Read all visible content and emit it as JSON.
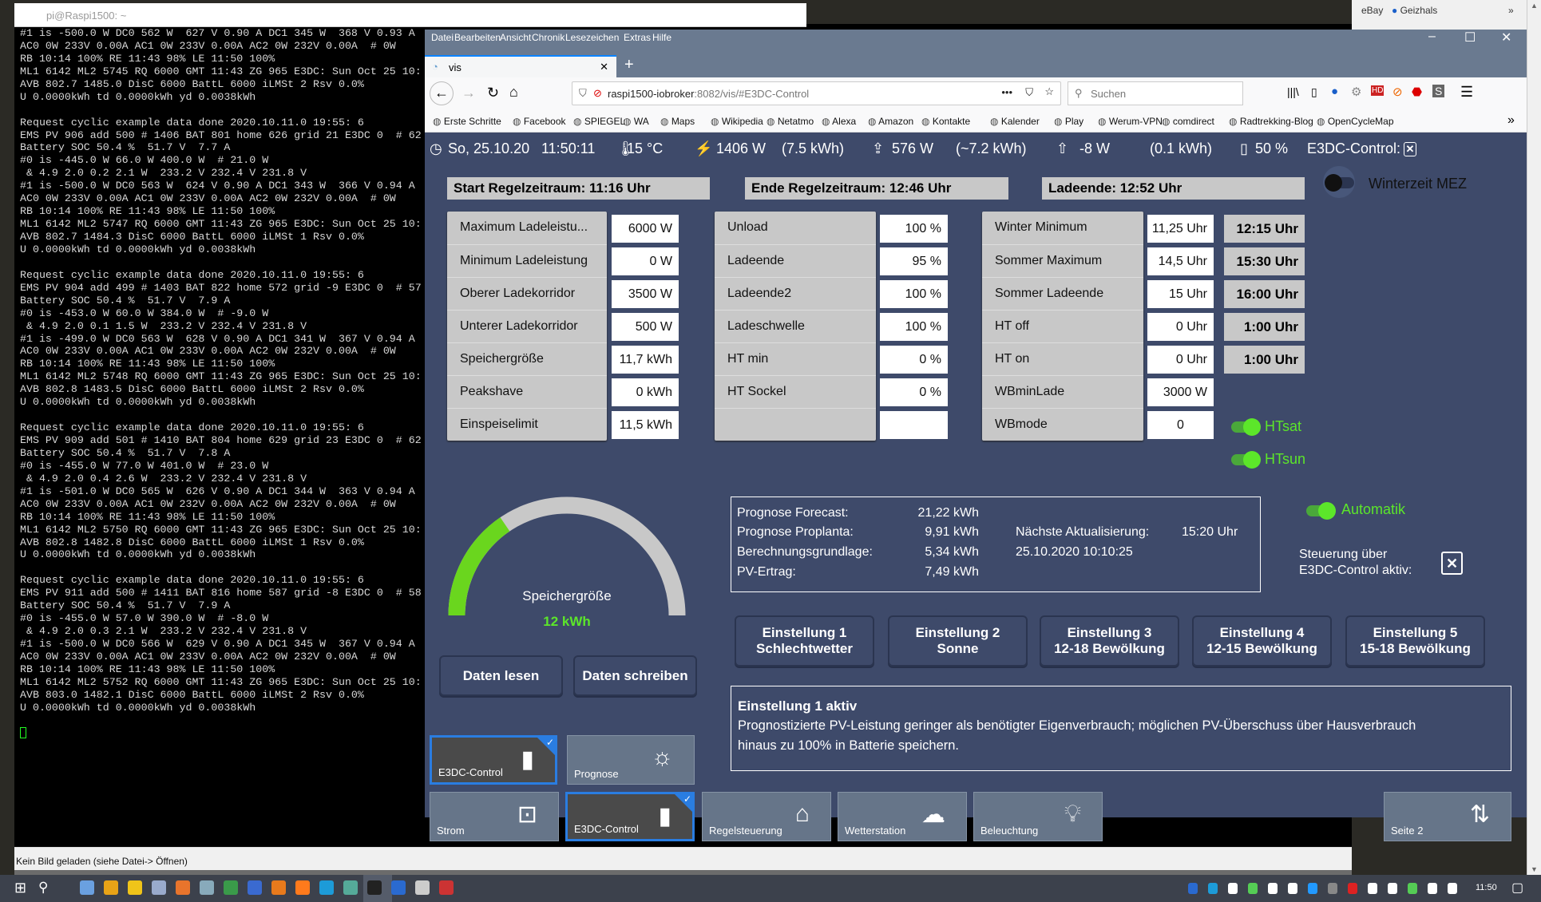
{
  "putty": {
    "title": "pi@Raspi1500: ~",
    "lines": [
      "#1 is -500.0 W DC0 562 W  627 V 0.90 A DC1 345 W  368 V 0.93 A",
      "AC0 0W 233V 0.00A AC1 0W 233V 0.00A AC2 0W 232V 0.00A  # 0W",
      "RB 10:14 100% RE 11:43 98% LE 11:50 100%",
      "ML1 6142 ML2 5745 RQ 6000 GMT 11:43 ZG 965 E3DC: Sun Oct 25 10:",
      "AVB 802.7 1485.0 DisC 6000 BattL 6000 iLMSt 2 Rsv 0.0%",
      "U 0.0000kWh td 0.0000kWh yd 0.0038kWh",
      "",
      "Request cyclic example data done 2020.10.11.0 19:55: 6",
      "EMS PV 906 add 500 # 1406 BAT 801 home 626 grid 21 E3DC 0  # 62",
      "Battery SOC 50.4 %  51.7 V  7.7 A",
      "#0 is -445.0 W 66.0 W 400.0 W  # 21.0 W",
      " & 4.9 2.0 0.2 2.1 W  233.2 V 232.4 V 231.8 V",
      "#1 is -500.0 W DC0 563 W  624 V 0.90 A DC1 343 W  366 V 0.94 A",
      "AC0 0W 233V 0.00A AC1 0W 233V 0.00A AC2 0W 232V 0.00A  # 0W",
      "RB 10:14 100% RE 11:43 98% LE 11:50 100%",
      "ML1 6142 ML2 5747 RQ 6000 GMT 11:43 ZG 965 E3DC: Sun Oct 25 10:",
      "AVB 802.7 1484.3 DisC 6000 BattL 6000 iLMSt 1 Rsv 0.0%",
      "U 0.0000kWh td 0.0000kWh yd 0.0038kWh",
      "",
      "Request cyclic example data done 2020.10.11.0 19:55: 6",
      "EMS PV 904 add 499 # 1403 BAT 822 home 572 grid -9 E3DC 0  # 57",
      "Battery SOC 50.4 %  51.7 V  7.9 A",
      "#0 is -453.0 W 60.0 W 384.0 W  # -9.0 W",
      " & 4.9 2.0 0.1 1.5 W  233.2 V 232.4 V 231.8 V",
      "#1 is -499.0 W DC0 563 W  628 V 0.90 A DC1 341 W  367 V 0.94 A",
      "AC0 0W 233V 0.00A AC1 0W 233V 0.00A AC2 0W 232V 0.00A  # 0W",
      "RB 10:14 100% RE 11:43 98% LE 11:50 100%",
      "ML1 6142 ML2 5748 RQ 6000 GMT 11:43 ZG 965 E3DC: Sun Oct 25 10:",
      "AVB 802.8 1483.5 DisC 6000 BattL 6000 iLMSt 2 Rsv 0.0%",
      "U 0.0000kWh td 0.0000kWh yd 0.0038kWh",
      "",
      "Request cyclic example data done 2020.10.11.0 19:55: 6",
      "EMS PV 909 add 501 # 1410 BAT 804 home 629 grid 23 E3DC 0  # 62",
      "Battery SOC 50.4 %  51.7 V  7.8 A",
      "#0 is -455.0 W 77.0 W 401.0 W  # 23.0 W",
      " & 4.9 2.0 0.4 2.6 W  233.2 V 232.4 V 231.8 V",
      "#1 is -501.0 W DC0 565 W  626 V 0.90 A DC1 344 W  363 V 0.94 A",
      "AC0 0W 233V 0.00A AC1 0W 232V 0.00A AC2 0W 232V 0.00A  # 0W",
      "RB 10:14 100% RE 11:43 98% LE 11:50 100%",
      "ML1 6142 ML2 5750 RQ 6000 GMT 11:43 ZG 965 E3DC: Sun Oct 25 10:",
      "AVB 802.8 1482.8 DisC 6000 BattL 6000 iLMSt 1 Rsv 0.0%",
      "U 0.0000kWh td 0.0000kWh yd 0.0038kWh",
      "",
      "Request cyclic example data done 2020.10.11.0 19:55: 6",
      "EMS PV 911 add 500 # 1411 BAT 816 home 587 grid -8 E3DC 0  # 58",
      "Battery SOC 50.4 %  51.7 V  7.9 A",
      "#0 is -455.0 W 57.0 W 390.0 W  # -8.0 W",
      " & 4.9 2.0 0.3 2.1 W  233.2 V 232.4 V 231.8 V",
      "#1 is -500.0 W DC0 566 W  629 V 0.90 A DC1 345 W  367 V 0.94 A",
      "AC0 0W 233V 0.00A AC1 0W 233V 0.00A AC2 0W 232V 0.00A  # 0W",
      "RB 10:14 100% RE 11:43 98% LE 11:50 100%",
      "ML1 6142 ML2 5752 RQ 6000 GMT 11:43 ZG 965 E3DC: Sun Oct 25 10:",
      "AVB 803.0 1482.1 DisC 6000 BattL 6000 iLMSt 2 Rsv 0.0%",
      "U 0.0000kWh td 0.0000kWh yd 0.0038kWh",
      ""
    ]
  },
  "viewer": {
    "status": "Kein Bild geladen (siehe Datei-> Öffnen)"
  },
  "behind": {
    "bookmarks": [
      "eBay",
      "Geizhals"
    ],
    "more": "»"
  },
  "taskbar": {
    "time": "11:50"
  },
  "browser": {
    "menu": [
      "Datei",
      "Bearbeiten",
      "Ansicht",
      "Chronik",
      "Lesezeichen",
      "Extras",
      "Hilfe"
    ],
    "tab": "vis",
    "url_host": "raspi1500-iobroker",
    "url_rest": ":8082/vis/#E3DC-Control",
    "search_placeholder": "Suchen",
    "bookmarks": [
      "Erste Schritte",
      "Facebook",
      "SPIEGEL",
      "WA",
      "Maps",
      "Wikipedia",
      "Netatmo",
      "Alexa",
      "Amazon",
      "Kontakte",
      "Kalender",
      "Play",
      "Werum-VPN",
      "comdirect",
      "Radtrekking-Blog",
      "OpenCycleMap"
    ],
    "bookmarks_more": "»"
  },
  "status": {
    "date": "So, 25.10.20",
    "time": "11:50:11",
    "temp": "15 °C",
    "pv": "1406 W",
    "pv_energy": "(7.5 kWh)",
    "home": "576 W",
    "home_energy": "(~7.2 kWh)",
    "grid": "-8 W",
    "grid_energy": "(0.1 kWh)",
    "battery": "50 %",
    "e3dc_label": "E3DC-Control:",
    "e3dc_state": "✕"
  },
  "headers": {
    "start": "Start Regelzeitraum: 11:16 Uhr",
    "ende": "Ende Regelzeitraum: 12:46 Uhr",
    "ladeende": "Ladeende: 12:52 Uhr",
    "winterzeit": "Winterzeit MEZ"
  },
  "group1": [
    [
      "Maximum Ladeleistu...",
      "6000 W"
    ],
    [
      "Minimum Ladeleistung",
      "0 W"
    ],
    [
      "Oberer Ladekorridor",
      "3500 W"
    ],
    [
      "Unterer Ladekorridor",
      "500 W"
    ],
    [
      "Speichergröße",
      "11,7 kWh"
    ],
    [
      "Peakshave",
      "0 kWh"
    ],
    [
      "Einspeiselimit",
      "11,5 kWh"
    ]
  ],
  "group2": [
    [
      "Unload",
      "100 %"
    ],
    [
      "Ladeende",
      "95 %"
    ],
    [
      "Ladeende2",
      "100 %"
    ],
    [
      "Ladeschwelle",
      "100 %"
    ],
    [
      "HT min",
      "0 %"
    ],
    [
      "HT Sockel",
      "0 %"
    ],
    [
      "",
      ""
    ]
  ],
  "group3": [
    [
      "Winter Minimum",
      "11,25 Uhr",
      "12:15 Uhr"
    ],
    [
      "Sommer Maximum",
      "14,5 Uhr",
      "15:30 Uhr"
    ],
    [
      "Sommer Ladeende",
      "15 Uhr",
      "16:00 Uhr"
    ],
    [
      "HT off",
      "0 Uhr",
      "1:00 Uhr"
    ],
    [
      "HT on",
      "0 Uhr",
      "1:00 Uhr"
    ],
    [
      "WBminLade",
      "3000 W",
      ""
    ],
    [
      "WBmode",
      "0",
      ""
    ]
  ],
  "toggles": {
    "htsat": "HTsat",
    "htsun": "HTsun",
    "automatik": "Automatik",
    "winterzeit_on": false
  },
  "gauge": {
    "label": "Speichergröße",
    "value": "12 kWh",
    "fill_fraction": 0.31,
    "fill_color": "#6ad61e",
    "track_color": "#c8c8c8"
  },
  "buttons": {
    "read": "Daten lesen",
    "write": "Daten schreiben"
  },
  "prognose": {
    "forecast_label": "Prognose Forecast:",
    "forecast": "21,22 kWh",
    "proplanta_label": "Prognose Proplanta:",
    "proplanta": "9,91 kWh",
    "basis_label": "Berechnungsgrundlage:",
    "basis": "5,34 kWh",
    "ertrag_label": "PV-Ertrag:",
    "ertrag": "7,49 kWh",
    "next_label": "Nächste Aktualisierung:",
    "next": "15:20 Uhr",
    "timestamp": "25.10.2020 10:10:25"
  },
  "steuerung": {
    "line1": "Steuerung über",
    "line2": "E3DC-Control aktiv:",
    "state": "✕"
  },
  "einstellungen": [
    [
      "Einstellung 1",
      "Schlechtwetter"
    ],
    [
      "Einstellung 2",
      "Sonne"
    ],
    [
      "Einstellung 3",
      "12-18 Bewölkung"
    ],
    [
      "Einstellung 4",
      "12-15 Bewölkung"
    ],
    [
      "Einstellung 5",
      "15-18 Bewölkung"
    ]
  ],
  "info": {
    "title": "Einstellung 1 aktiv",
    "text1": "Prognostizierte PV-Leistung geringer als benötigter Eigenverbrauch; möglichen PV-Überschuss über Hausverbrauch",
    "text2": "hinaus zu 100% in Batterie speichern."
  },
  "tiles_top": [
    {
      "label": "E3DC-Control",
      "icon": "battery-icon",
      "selected": true
    },
    {
      "label": "Prognose",
      "icon": "sun-lux-icon",
      "selected": false
    }
  ],
  "tiles_bottom": [
    {
      "label": "Strom",
      "icon": "socket-icon",
      "selected": false
    },
    {
      "label": "E3DC-Control",
      "icon": "battery-icon",
      "selected": true
    },
    {
      "label": "Regelsteuerung",
      "icon": "house-auto-icon",
      "selected": false
    },
    {
      "label": "Wetterstation",
      "icon": "weather-icon",
      "selected": false
    },
    {
      "label": "Beleuchtung",
      "icon": "bulb-icon",
      "selected": false
    }
  ],
  "tile_page": {
    "label": "Seite 2",
    "icon": "swap-icon"
  },
  "colors": {
    "content_bg": "#3e4a6a",
    "accent_green": "#5ce62a",
    "selected_blue": "#2a7de1"
  }
}
